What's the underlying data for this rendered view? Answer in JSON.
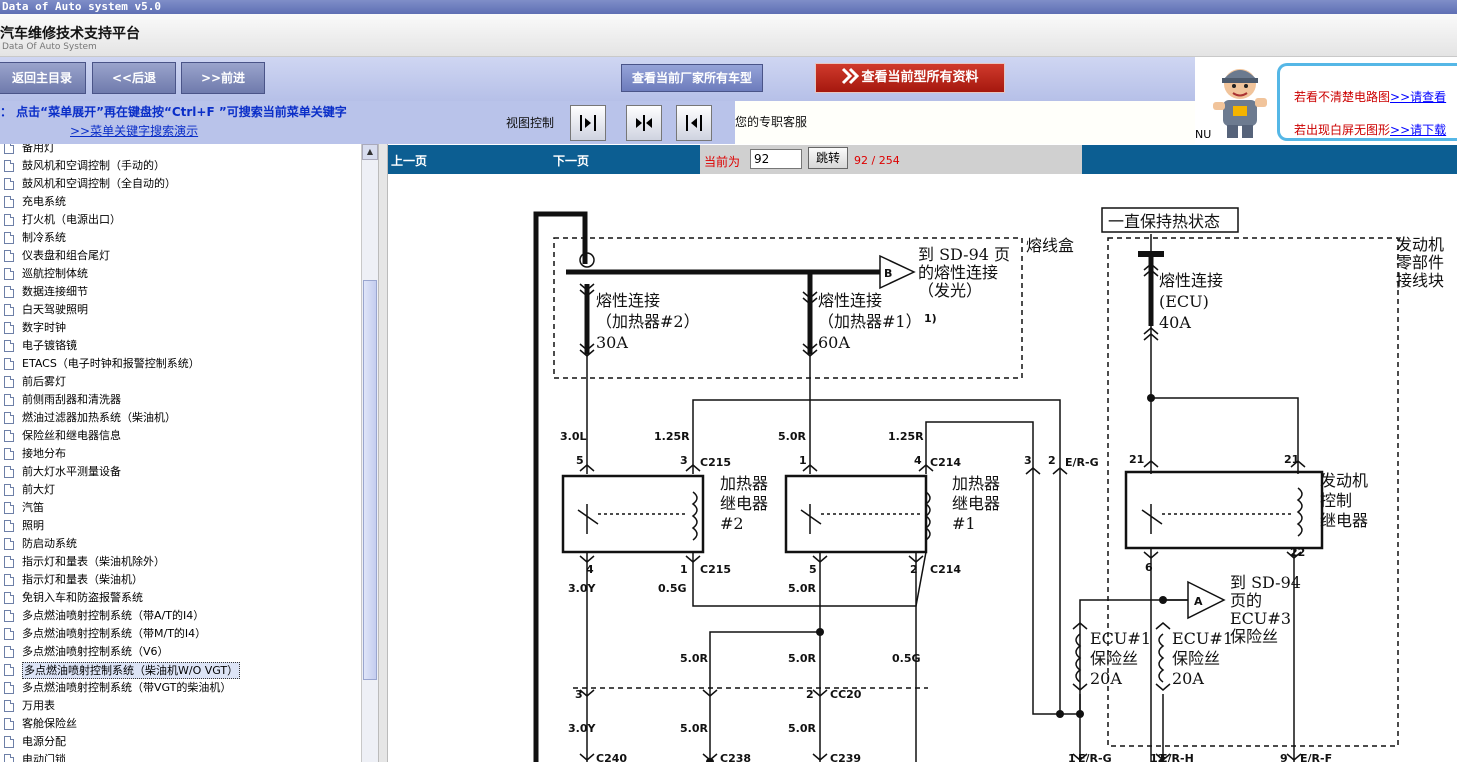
{
  "window": {
    "title": "Data of Auto system v5.0"
  },
  "banner": {
    "title": "汽车维修技术支持平台",
    "subtitle": "Data Of Auto System"
  },
  "toolbar": {
    "home_label": "返回主目录",
    "back_label": "<<后退",
    "forward_label": ">>前进",
    "cars_label": "查看当前厂家所有车型",
    "data_label": "查看当前型所有资料"
  },
  "promo": {
    "line1_text": "若看不清楚电路图",
    "line1_link": ">>请查看",
    "line2_text": "若出现白屏无图形",
    "line2_link": ">>请下载",
    "nu_text": "NU"
  },
  "hint": {
    "line1": "：  点击“菜单展开”再在键盘按“Ctrl+F ”可搜索当前菜单关键字",
    "line2": ">>菜单关键字搜索演示"
  },
  "view": {
    "label": "视图控制"
  },
  "service": {
    "text": "您的专职客服"
  },
  "tree": {
    "items": [
      "备用灯",
      "鼓风机和空调控制（手动的）",
      "鼓风机和空调控制（全自动的）",
      "充电系统",
      "打火机（电源出口）",
      "制冷系统",
      "仪表盘和组合尾灯",
      "巡航控制体统",
      "数据连接细节",
      "白天驾驶照明",
      "数字时钟",
      "电子镀铬镜",
      "ETACS（电子时钟和报警控制系统）",
      "前后雾灯",
      "前侧雨刮器和清洗器",
      "燃油过滤器加热系统（柴油机）",
      "保险丝和继电器信息",
      "接地分布",
      "前大灯水平测量设备",
      "前大灯",
      "汽笛",
      "照明",
      "防启动系统",
      "指示灯和量表（柴油机除外）",
      "指示灯和量表（柴油机）",
      "免钥入车和防盗报警系统",
      "多点燃油喷射控制系统（带A/T的I4）",
      "多点燃油喷射控制系统（带M/T的I4）",
      "多点燃油喷射控制系统（V6）",
      "多点燃油喷射控制系统（柴油机W/O VGT）",
      "多点燃油喷射控制系统（带VGT的柴油机）",
      "万用表",
      "客舱保险丝",
      "电源分配",
      "电动门锁"
    ],
    "selected_index": 29
  },
  "pager": {
    "prev_label": "上一页",
    "next_label": "下一页",
    "current_label": "当前为",
    "current_value": "92",
    "go_label": "跳转",
    "total_text": "92 / 254"
  },
  "diagram": {
    "always_hot": "一直保持热状态",
    "fuse_box": "熔线盒",
    "engine_block": [
      "发动机",
      "零部件",
      "接线块"
    ],
    "sd94_b": [
      "到 SD-94 页",
      "的熔性连接",
      "（发光）"
    ],
    "sd94_a": [
      "到 SD-94",
      "页的",
      "ECU#3",
      "保险丝"
    ],
    "fl_heater2": [
      "熔性连接",
      "（加热器#2）",
      "30A"
    ],
    "fl_heater1": [
      "熔性连接",
      "（加热器#1）",
      "60A"
    ],
    "fl_ecu": [
      "熔性连接",
      "(ECU)",
      "40A"
    ],
    "relay2": [
      "加热器",
      "继电器",
      "#2"
    ],
    "relay1": [
      "加热器",
      "继电器",
      "#1"
    ],
    "engine_relay": [
      "发动机",
      "控制",
      "继电器"
    ],
    "ecu1_fuse_a": [
      "ECU#1",
      "保险丝",
      "20A"
    ],
    "ecu1_fuse_b": [
      "ECU#1",
      "保险丝",
      "20A"
    ],
    "circle_b": "B",
    "circle_a": "A",
    "foot_mark": "1)",
    "wires": [
      "3.0L",
      "1.25R",
      "5.0R",
      "1.25R",
      "3.0Y",
      "0.5G",
      "5.0R",
      "5.0R",
      "5.0R",
      "0.5G",
      "3.0Y",
      "5.0R",
      "5.0R"
    ],
    "connectors": [
      "C215",
      "C215",
      "C214",
      "C214",
      "CC20",
      "C240",
      "C238",
      "C239",
      "E/R-G",
      "E/R-G",
      "E/R-H",
      "E/R-F"
    ],
    "pins": [
      "5",
      "3",
      "1",
      "4",
      "3",
      "2",
      "21",
      "21",
      "4",
      "1",
      "5",
      "2",
      "6",
      "22",
      "3",
      "2",
      "1",
      "12",
      "9"
    ]
  }
}
